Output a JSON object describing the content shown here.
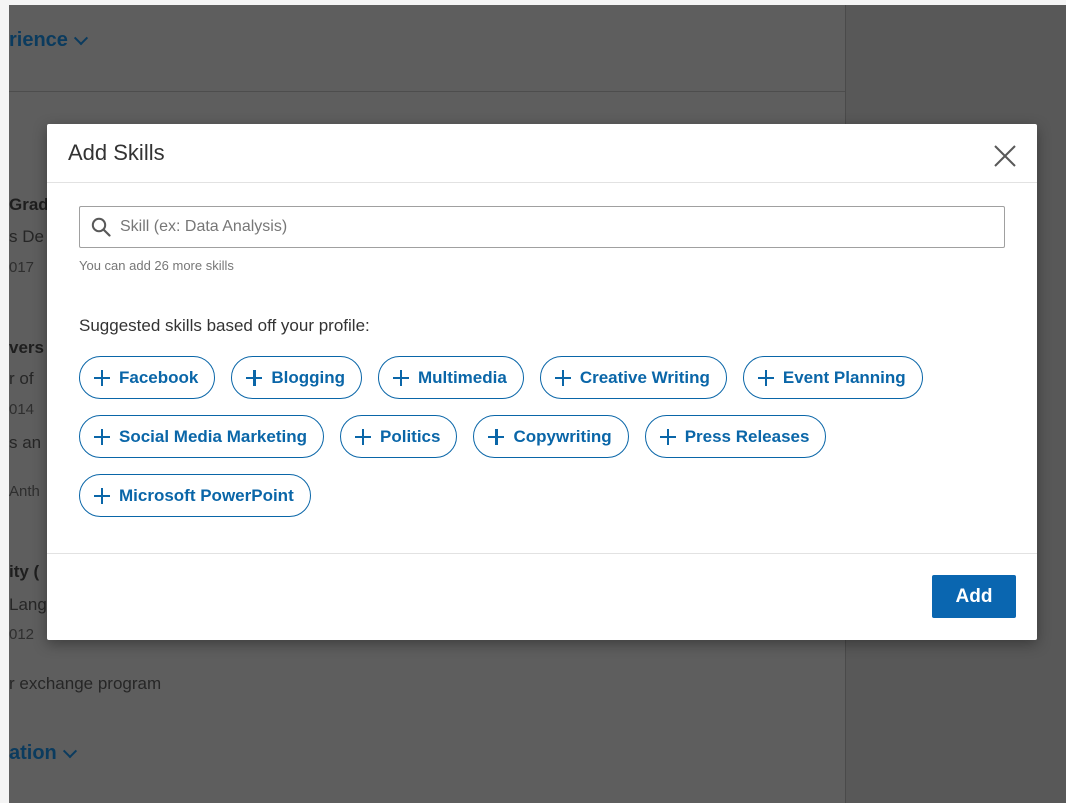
{
  "background": {
    "section_experience": "rience",
    "row1_title": "Grad",
    "row1_sub": "s De",
    "row1_date": "017",
    "row2_title": "vers",
    "row2_sub": "r of",
    "row2_date": "014",
    "row2_extra": "s an",
    "row2_extra2": "Anth",
    "row3_title": "ity (",
    "row3_sub": "Lang",
    "row3_date": "012",
    "row3_desc": "r exchange program",
    "section_education": "ation"
  },
  "modal": {
    "title": "Add Skills",
    "search": {
      "placeholder": "Skill (ex: Data Analysis)",
      "value": ""
    },
    "helper_text": "You can add 26 more skills",
    "suggest_heading": "Suggested skills based off your profile:",
    "suggestions": [
      [
        "Facebook",
        "Blogging",
        "Multimedia",
        "Creative Writing",
        "Event Planning"
      ],
      [
        "Social Media Marketing",
        "Politics",
        "Copywriting",
        "Press Releases"
      ],
      [
        "Microsoft PowerPoint"
      ]
    ],
    "add_label": "Add"
  },
  "colors": {
    "accent": "#0a66a8",
    "overlay": "#5e5e5e"
  },
  "icons": {
    "search": "search-icon",
    "close": "close-icon",
    "plus": "plus-icon",
    "chevron": "chevron-down-icon"
  }
}
